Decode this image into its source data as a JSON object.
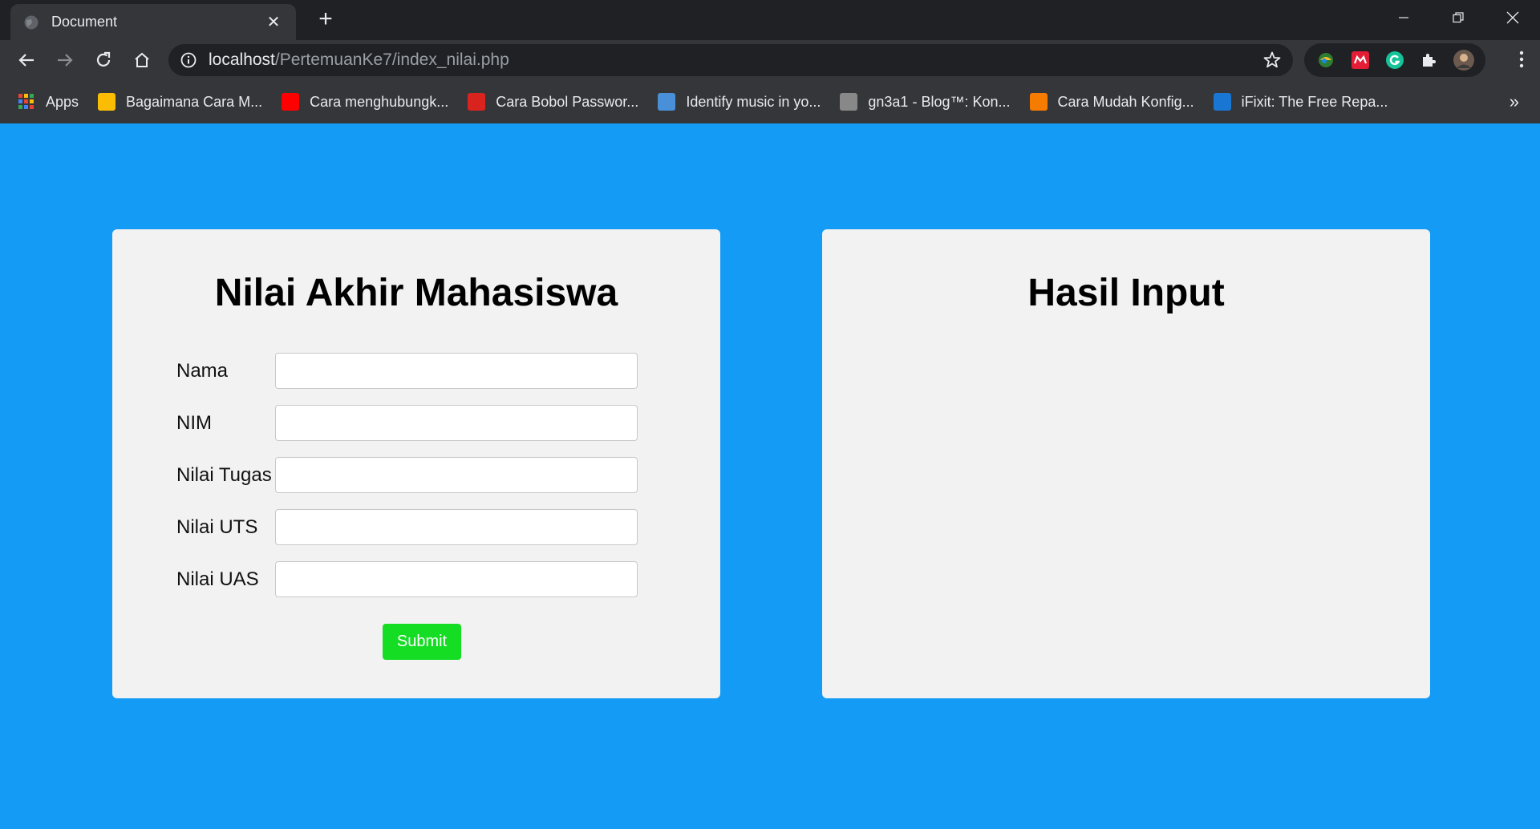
{
  "browser": {
    "tab_title": "Document",
    "new_tab_symbol": "+",
    "url_host": "localhost",
    "url_path": "/PertemuanKe7/index_nilai.php",
    "bookmarks": [
      {
        "label": "Apps",
        "icon": "apps-grid-icon",
        "color": "#34a853"
      },
      {
        "label": "Bagaimana Cara M...",
        "icon": "bookmark-site-icon",
        "color": "#fbbc04"
      },
      {
        "label": "Cara menghubungk...",
        "icon": "youtube-icon",
        "color": "#ff0000"
      },
      {
        "label": "Cara Bobol Passwor...",
        "icon": "red-chevron-icon",
        "color": "#d9231f"
      },
      {
        "label": "Identify music in yo...",
        "icon": "music-icon",
        "color": "#4a90d9"
      },
      {
        "label": "gn3a1 - Blog™: Kon...",
        "icon": "blog-thumbnail-icon",
        "color": "#888888"
      },
      {
        "label": "Cara Mudah Konfig...",
        "icon": "blogger-icon",
        "color": "#f57c00"
      },
      {
        "label": "iFixit: The Free Repa...",
        "icon": "ifixit-icon",
        "color": "#1976d2"
      }
    ],
    "more_bookmarks": "»"
  },
  "form_card": {
    "title": "Nilai Akhir Mahasiswa",
    "fields": [
      {
        "label": "Nama",
        "value": ""
      },
      {
        "label": "NIM",
        "value": ""
      },
      {
        "label": "Nilai Tugas",
        "value": ""
      },
      {
        "label": "Nilai UTS",
        "value": ""
      },
      {
        "label": "Nilai UAS",
        "value": ""
      }
    ],
    "submit_label": "Submit"
  },
  "result_card": {
    "title": "Hasil Input"
  },
  "colors": {
    "page_background": "#139bf6",
    "card_background": "#f2f2f2",
    "submit_button": "#14dd24"
  }
}
